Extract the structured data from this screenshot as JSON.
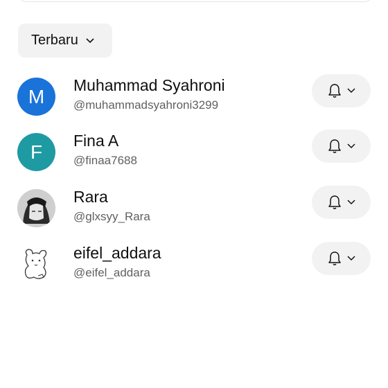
{
  "sort": {
    "label": "Terbaru",
    "icon": "chevron-down-icon"
  },
  "subscriptions": [
    {
      "initial": "M",
      "avatar_color": "#1a73d9",
      "avatar_type": "letter",
      "name": "Muhammad Syahroni",
      "handle": "@muhammadsyahroni3299"
    },
    {
      "initial": "F",
      "avatar_color": "#1e9aa3",
      "avatar_type": "letter",
      "name": "Fina A",
      "handle": "@finaa7688"
    },
    {
      "initial": "",
      "avatar_type": "photo",
      "name": "Rara",
      "handle": "@glxsyy_Rara"
    },
    {
      "initial": "",
      "avatar_type": "sketch",
      "name": "eifel_addara",
      "handle": "@eifel_addara"
    }
  ],
  "notify_button": {
    "icon": "bell-icon",
    "chevron": "chevron-down-icon"
  }
}
